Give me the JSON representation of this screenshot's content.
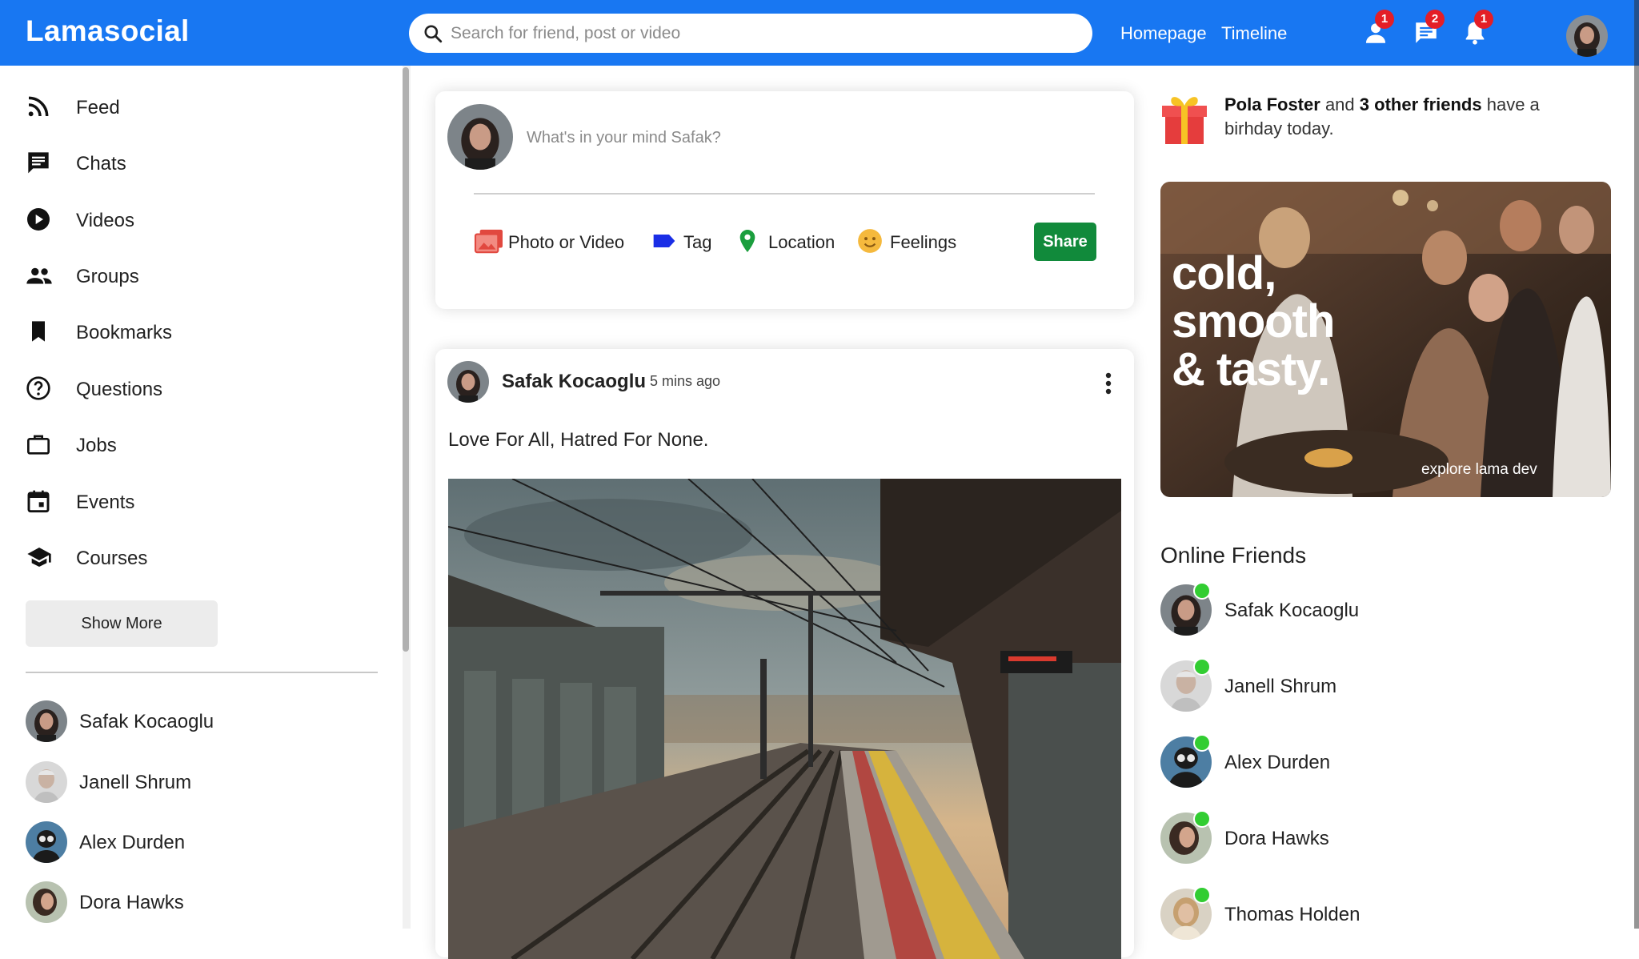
{
  "topbar": {
    "logo": "Lamasocial",
    "search_placeholder": "Search for friend, post or video",
    "links": [
      "Homepage",
      "Timeline"
    ],
    "badges": {
      "friend_requests": "1",
      "messages": "2",
      "notifications": "1"
    },
    "brand_color": "#1877f2"
  },
  "sidebar": {
    "items": [
      {
        "label": "Feed",
        "icon": "rss-feed-icon"
      },
      {
        "label": "Chats",
        "icon": "chat-icon"
      },
      {
        "label": "Videos",
        "icon": "play-circle-icon"
      },
      {
        "label": "Groups",
        "icon": "group-icon"
      },
      {
        "label": "Bookmarks",
        "icon": "bookmark-icon"
      },
      {
        "label": "Questions",
        "icon": "help-circle-icon"
      },
      {
        "label": "Jobs",
        "icon": "briefcase-icon"
      },
      {
        "label": "Events",
        "icon": "calendar-icon"
      },
      {
        "label": "Courses",
        "icon": "school-icon"
      }
    ],
    "show_more": "Show More",
    "friends": [
      "Safak Kocaoglu",
      "Janell Shrum",
      "Alex Durden",
      "Dora Hawks"
    ]
  },
  "share": {
    "placeholder": "What's in your mind Safak?",
    "options": [
      "Photo or Video",
      "Tag",
      "Location",
      "Feelings"
    ],
    "button": "Share",
    "button_color": "#118a3b"
  },
  "post": {
    "user": "Safak Kocaoglu",
    "time": "5 mins ago",
    "text": "Love For All, Hatred For None."
  },
  "rightbar": {
    "birthday": {
      "name": "Pola Foster",
      "mid": "and",
      "others": "3 other friends",
      "rest": "have a birhday today."
    },
    "ad": {
      "line1": "cold,",
      "line2": "smooth",
      "line3": "& tasty.",
      "sub": "explore lama dev"
    },
    "online_title": "Online Friends",
    "online_friends": [
      "Safak Kocaoglu",
      "Janell Shrum",
      "Alex Durden",
      "Dora Hawks",
      "Thomas Holden"
    ],
    "online_color": "#32cd32"
  }
}
